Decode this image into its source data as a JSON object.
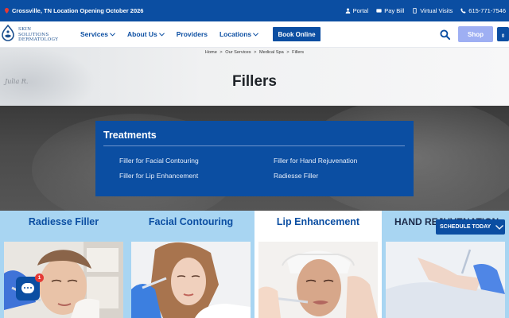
{
  "topbar": {
    "announcement": "Crossville, TN Location Opening October 2026",
    "links": [
      {
        "label": "Portal",
        "icon": "person-icon"
      },
      {
        "label": "Pay Bill",
        "icon": "card-icon"
      },
      {
        "label": "Virtual Visits",
        "icon": "phone-device-icon"
      },
      {
        "label": "615-771-7546",
        "icon": "phone-icon"
      }
    ]
  },
  "header": {
    "logo_lines": [
      "SKIN",
      "SOLUTIONS",
      "DERMATOLOGY"
    ],
    "nav": [
      {
        "label": "Services",
        "dropdown": true
      },
      {
        "label": "About Us",
        "dropdown": true
      },
      {
        "label": "Providers",
        "dropdown": false
      },
      {
        "label": "Locations",
        "dropdown": true
      }
    ],
    "book_label": "Book Online",
    "shop_label": "Shop",
    "cart_count": "0"
  },
  "hero": {
    "breadcrumb": [
      "Home",
      "Our Services",
      "Medical Spa",
      "Fillers"
    ],
    "breadcrumb_sep": ">",
    "title": "Fillers",
    "signature": "Julia R."
  },
  "treatments": {
    "title": "Treatments",
    "links": [
      "Filler for Facial Contouring",
      "Filler for Hand Rejuvenation",
      "Filler for Lip Enhancement",
      "Radiesse Filler"
    ]
  },
  "tabs": [
    {
      "label": "Radiesse Filler",
      "active": false
    },
    {
      "label": "Facial Contouring",
      "active": false
    },
    {
      "label": "Lip Enhancement",
      "active": true
    },
    {
      "label": "HAND REJUVENATION",
      "active": false
    }
  ],
  "chat": {
    "badge": "1"
  },
  "schedule_label": "SCHEDULE TODAY",
  "colors": {
    "brand_blue": "#0b4ea2",
    "tab_light": "#a8d5f2",
    "shop": "#9eaff3"
  }
}
